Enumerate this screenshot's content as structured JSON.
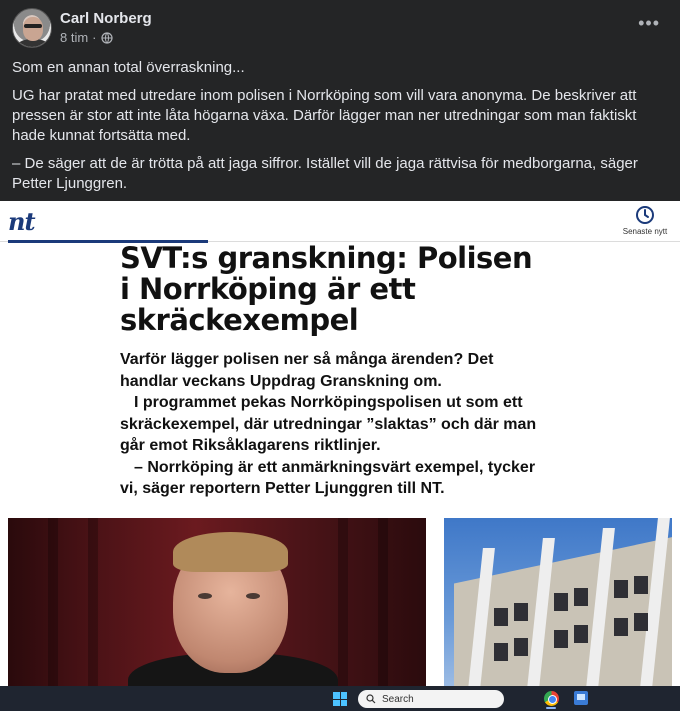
{
  "post": {
    "author": "Carl Norberg",
    "time": "8 tim",
    "separator": "·",
    "more_icon": "more-horizontal-icon",
    "paragraphs": [
      "Som en annan total överraskning...",
      "UG har pratat med utredare inom polisen i Norrköping som vill vara anonyma. De beskriver att pressen är stor att inte låta högarna växa. Därför lägger man ner utredningar som man faktiskt hade kunnat fortsätta med.",
      "– De säger att de är trötta på att jaga siffror. Istället vill de jaga rättvisa för medborgarna, säger Petter Ljunggren."
    ]
  },
  "article": {
    "logo": "nt",
    "latest_label": "Senaste nytt",
    "headline": "SVT:s granskning: Polisen i Norrköping är ett skräckexempel",
    "lead": [
      "Varför lägger polisen ner så många ärenden? Det handlar veckans Uppdrag Granskning om.",
      "I programmet pekas Norrköpingspolisen ut som ett skräckexempel, där utredningar ”slaktas” och där man går emot Riksåklagarens riktlinjer.",
      "– Norrköping är ett anmärkningsvärt exempel, tycker vi, säger reportern Petter Ljunggren till NT."
    ]
  },
  "taskbar": {
    "search_placeholder": "Search",
    "apps": [
      "windows-start-icon",
      "chrome-icon",
      "outlook-icon"
    ]
  },
  "colors": {
    "fb_bg": "#242526",
    "nt_blue": "#1b3a7a",
    "taskbar_bg": "#1f2530"
  }
}
